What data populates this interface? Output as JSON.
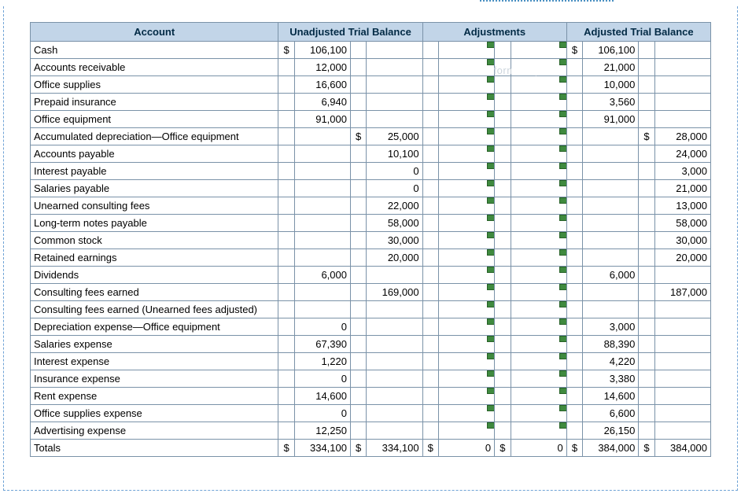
{
  "headers": {
    "account": "Account",
    "unadjusted": "Unadjusted Trial Balance",
    "adjustments": "Adjustments",
    "adjusted": "Adjusted Trial Balance"
  },
  "currency": "$",
  "watermark": "Free-form Snip",
  "rows": [
    {
      "account": "Cash",
      "un_dr_sym": "$",
      "un_dr": "106,100",
      "un_cr_sym": "",
      "un_cr": "",
      "ad_dr_sym": "$",
      "ad_dr": "106,100",
      "ad_cr_sym": "",
      "ad_cr": ""
    },
    {
      "account": "Accounts receivable",
      "un_dr_sym": "",
      "un_dr": "12,000",
      "un_cr_sym": "",
      "un_cr": "",
      "ad_dr_sym": "",
      "ad_dr": "21,000",
      "ad_cr_sym": "",
      "ad_cr": ""
    },
    {
      "account": "Office supplies",
      "un_dr_sym": "",
      "un_dr": "16,600",
      "un_cr_sym": "",
      "un_cr": "",
      "ad_dr_sym": "",
      "ad_dr": "10,000",
      "ad_cr_sym": "",
      "ad_cr": ""
    },
    {
      "account": "Prepaid insurance",
      "un_dr_sym": "",
      "un_dr": "6,940",
      "un_cr_sym": "",
      "un_cr": "",
      "ad_dr_sym": "",
      "ad_dr": "3,560",
      "ad_cr_sym": "",
      "ad_cr": ""
    },
    {
      "account": "Office equipment",
      "un_dr_sym": "",
      "un_dr": "91,000",
      "un_cr_sym": "",
      "un_cr": "",
      "ad_dr_sym": "",
      "ad_dr": "91,000",
      "ad_cr_sym": "",
      "ad_cr": ""
    },
    {
      "account": "Accumulated depreciation—Office equipment",
      "un_dr_sym": "",
      "un_dr": "",
      "un_cr_sym": "$",
      "un_cr": "25,000",
      "ad_dr_sym": "",
      "ad_dr": "",
      "ad_cr_sym": "$",
      "ad_cr": "28,000"
    },
    {
      "account": "Accounts payable",
      "un_dr_sym": "",
      "un_dr": "",
      "un_cr_sym": "",
      "un_cr": "10,100",
      "ad_dr_sym": "",
      "ad_dr": "",
      "ad_cr_sym": "",
      "ad_cr": "24,000"
    },
    {
      "account": "Interest payable",
      "un_dr_sym": "",
      "un_dr": "",
      "un_cr_sym": "",
      "un_cr": "0",
      "ad_dr_sym": "",
      "ad_dr": "",
      "ad_cr_sym": "",
      "ad_cr": "3,000"
    },
    {
      "account": "Salaries payable",
      "un_dr_sym": "",
      "un_dr": "",
      "un_cr_sym": "",
      "un_cr": "0",
      "ad_dr_sym": "",
      "ad_dr": "",
      "ad_cr_sym": "",
      "ad_cr": "21,000"
    },
    {
      "account": "Unearned consulting fees",
      "un_dr_sym": "",
      "un_dr": "",
      "un_cr_sym": "",
      "un_cr": "22,000",
      "ad_dr_sym": "",
      "ad_dr": "",
      "ad_cr_sym": "",
      "ad_cr": "13,000"
    },
    {
      "account": "Long-term notes payable",
      "un_dr_sym": "",
      "un_dr": "",
      "un_cr_sym": "",
      "un_cr": "58,000",
      "ad_dr_sym": "",
      "ad_dr": "",
      "ad_cr_sym": "",
      "ad_cr": "58,000"
    },
    {
      "account": "Common stock",
      "un_dr_sym": "",
      "un_dr": "",
      "un_cr_sym": "",
      "un_cr": "30,000",
      "ad_dr_sym": "",
      "ad_dr": "",
      "ad_cr_sym": "",
      "ad_cr": "30,000"
    },
    {
      "account": "Retained earnings",
      "un_dr_sym": "",
      "un_dr": "",
      "un_cr_sym": "",
      "un_cr": "20,000",
      "ad_dr_sym": "",
      "ad_dr": "",
      "ad_cr_sym": "",
      "ad_cr": "20,000"
    },
    {
      "account": "Dividends",
      "un_dr_sym": "",
      "un_dr": "6,000",
      "un_cr_sym": "",
      "un_cr": "",
      "ad_dr_sym": "",
      "ad_dr": "6,000",
      "ad_cr_sym": "",
      "ad_cr": ""
    },
    {
      "account": "Consulting fees earned",
      "un_dr_sym": "",
      "un_dr": "",
      "un_cr_sym": "",
      "un_cr": "169,000",
      "ad_dr_sym": "",
      "ad_dr": "",
      "ad_cr_sym": "",
      "ad_cr": "187,000"
    },
    {
      "account": "Consulting fees earned (Unearned fees adjusted)",
      "un_dr_sym": "",
      "un_dr": "",
      "un_cr_sym": "",
      "un_cr": "",
      "ad_dr_sym": "",
      "ad_dr": "",
      "ad_cr_sym": "",
      "ad_cr": ""
    },
    {
      "account": "Depreciation expense—Office equipment",
      "un_dr_sym": "",
      "un_dr": "0",
      "un_cr_sym": "",
      "un_cr": "",
      "ad_dr_sym": "",
      "ad_dr": "3,000",
      "ad_cr_sym": "",
      "ad_cr": ""
    },
    {
      "account": "Salaries expense",
      "un_dr_sym": "",
      "un_dr": "67,390",
      "un_cr_sym": "",
      "un_cr": "",
      "ad_dr_sym": "",
      "ad_dr": "88,390",
      "ad_cr_sym": "",
      "ad_cr": ""
    },
    {
      "account": "Interest expense",
      "un_dr_sym": "",
      "un_dr": "1,220",
      "un_cr_sym": "",
      "un_cr": "",
      "ad_dr_sym": "",
      "ad_dr": "4,220",
      "ad_cr_sym": "",
      "ad_cr": ""
    },
    {
      "account": "Insurance expense",
      "un_dr_sym": "",
      "un_dr": "0",
      "un_cr_sym": "",
      "un_cr": "",
      "ad_dr_sym": "",
      "ad_dr": "3,380",
      "ad_cr_sym": "",
      "ad_cr": ""
    },
    {
      "account": "Rent expense",
      "un_dr_sym": "",
      "un_dr": "14,600",
      "un_cr_sym": "",
      "un_cr": "",
      "ad_dr_sym": "",
      "ad_dr": "14,600",
      "ad_cr_sym": "",
      "ad_cr": ""
    },
    {
      "account": "Office supplies expense",
      "un_dr_sym": "",
      "un_dr": "0",
      "un_cr_sym": "",
      "un_cr": "",
      "ad_dr_sym": "",
      "ad_dr": "6,600",
      "ad_cr_sym": "",
      "ad_cr": ""
    },
    {
      "account": "Advertising expense",
      "un_dr_sym": "",
      "un_dr": "12,250",
      "un_cr_sym": "",
      "un_cr": "",
      "ad_dr_sym": "",
      "ad_dr": "26,150",
      "ad_cr_sym": "",
      "ad_cr": ""
    }
  ],
  "totals": {
    "account": "Totals",
    "un_dr_sym": "$",
    "un_dr": "334,100",
    "un_cr_sym": "$",
    "un_cr": "334,100",
    "adj_dr_sym": "$",
    "adj_dr": "0",
    "adj_cr_sym": "$",
    "adj_cr": "0",
    "ad_dr_sym": "$",
    "ad_dr": "384,000",
    "ad_cr_sym": "$",
    "ad_cr": "384,000"
  }
}
